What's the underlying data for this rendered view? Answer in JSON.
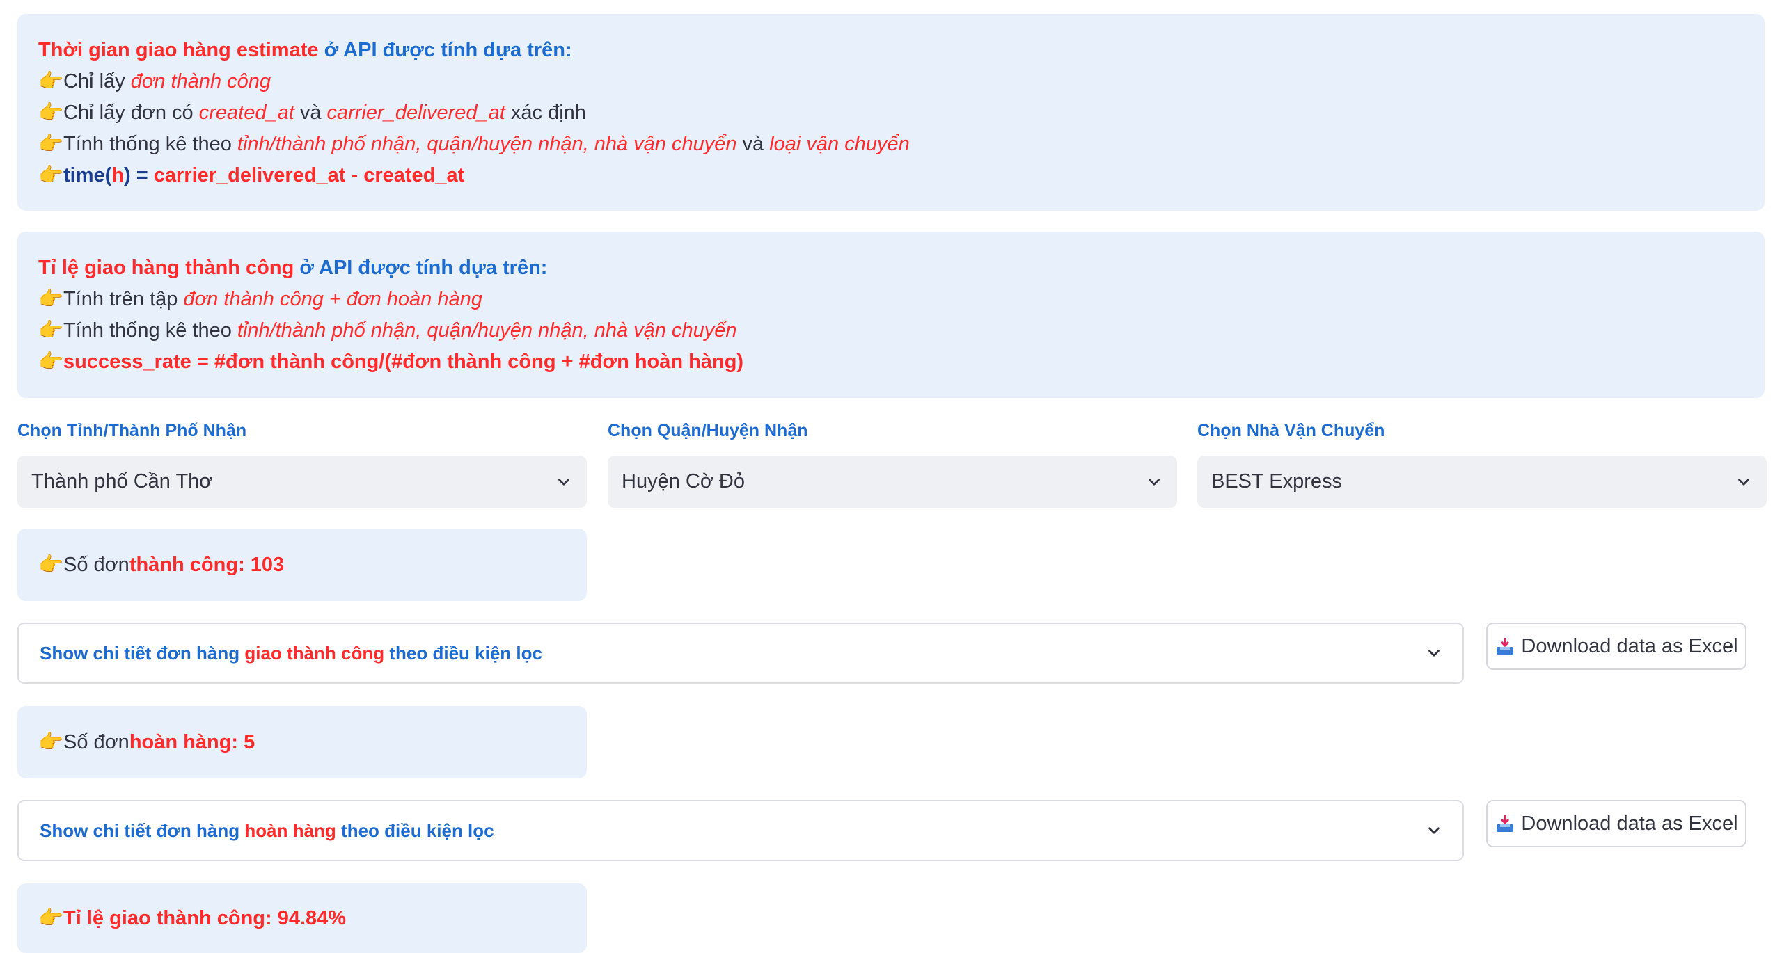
{
  "box1": {
    "title_red": "Thời gian giao hàng estimate",
    "title_blue": " ở API được tính dựa trên:",
    "line1_a": "Chỉ lấy ",
    "line1_b": "đơn thành công",
    "line2_a": "Chỉ lấy đơn có ",
    "line2_b": "created_at",
    "line2_c": " và ",
    "line2_d": "carrier_delivered_at",
    "line2_e": " xác định",
    "line3_a": "Tính thống kê theo ",
    "line3_b": "tỉnh/thành phố nhận, quận/huyện nhận, nhà vận chuyển",
    "line3_c": " và ",
    "line3_d": "loại vận chuyển",
    "line4_a": "time",
    "line4_b": "(",
    "line4_c": "h",
    "line4_d": ") = ",
    "line4_e": "carrier_delivered_at - created_at"
  },
  "box2": {
    "title_red": "Tỉ lệ giao hàng thành công",
    "title_blue": " ở API được tính dựa trên:",
    "line1_a": "Tính trên tập ",
    "line1_b": "đơn thành công + đơn hoàn hàng",
    "line2_a": "Tính thống kê theo ",
    "line2_b": "tỉnh/thành phố nhận, quận/huyện nhận, nhà vận chuyển",
    "line3": "success_rate = #đơn thành công/(#đơn thành công + #đơn hoàn hàng)"
  },
  "filters": {
    "province_label": "Chọn Tỉnh/Thành Phố Nhận",
    "province_value": "Thành phố Cần Thơ",
    "district_label": "Chọn Quận/Huyện Nhận",
    "district_value": "Huyện Cờ Đỏ",
    "carrier_label": "Chọn Nhà Vận Chuyển",
    "carrier_value": "BEST Express"
  },
  "metrics": {
    "success_a": "Số đơn ",
    "success_b": "thành công",
    "success_c": ": 103",
    "return_a": "Số đơn ",
    "return_b": "hoàn hàng",
    "return_c": ": 5",
    "rate_a": "Tỉ lệ giao thành công",
    "rate_b": ": 94.84%"
  },
  "expanders": {
    "success_a": "Show chi tiết đơn hàng ",
    "success_b": "giao thành công",
    "success_c": " theo điều kiện lọc",
    "return_a": "Show chi tiết đơn hàng ",
    "return_b": "hoàn hàng",
    "return_c": " theo điều kiện lọc"
  },
  "buttons": {
    "download_label": "Download data as Excel"
  },
  "icons": {
    "hand": "👉",
    "chevron": "chevron-down-icon",
    "download": "inbox-tray-icon"
  },
  "colors": {
    "red": "#ff2b2b",
    "blue": "#1c6bd0",
    "info_bg": "#e8f1fb"
  }
}
